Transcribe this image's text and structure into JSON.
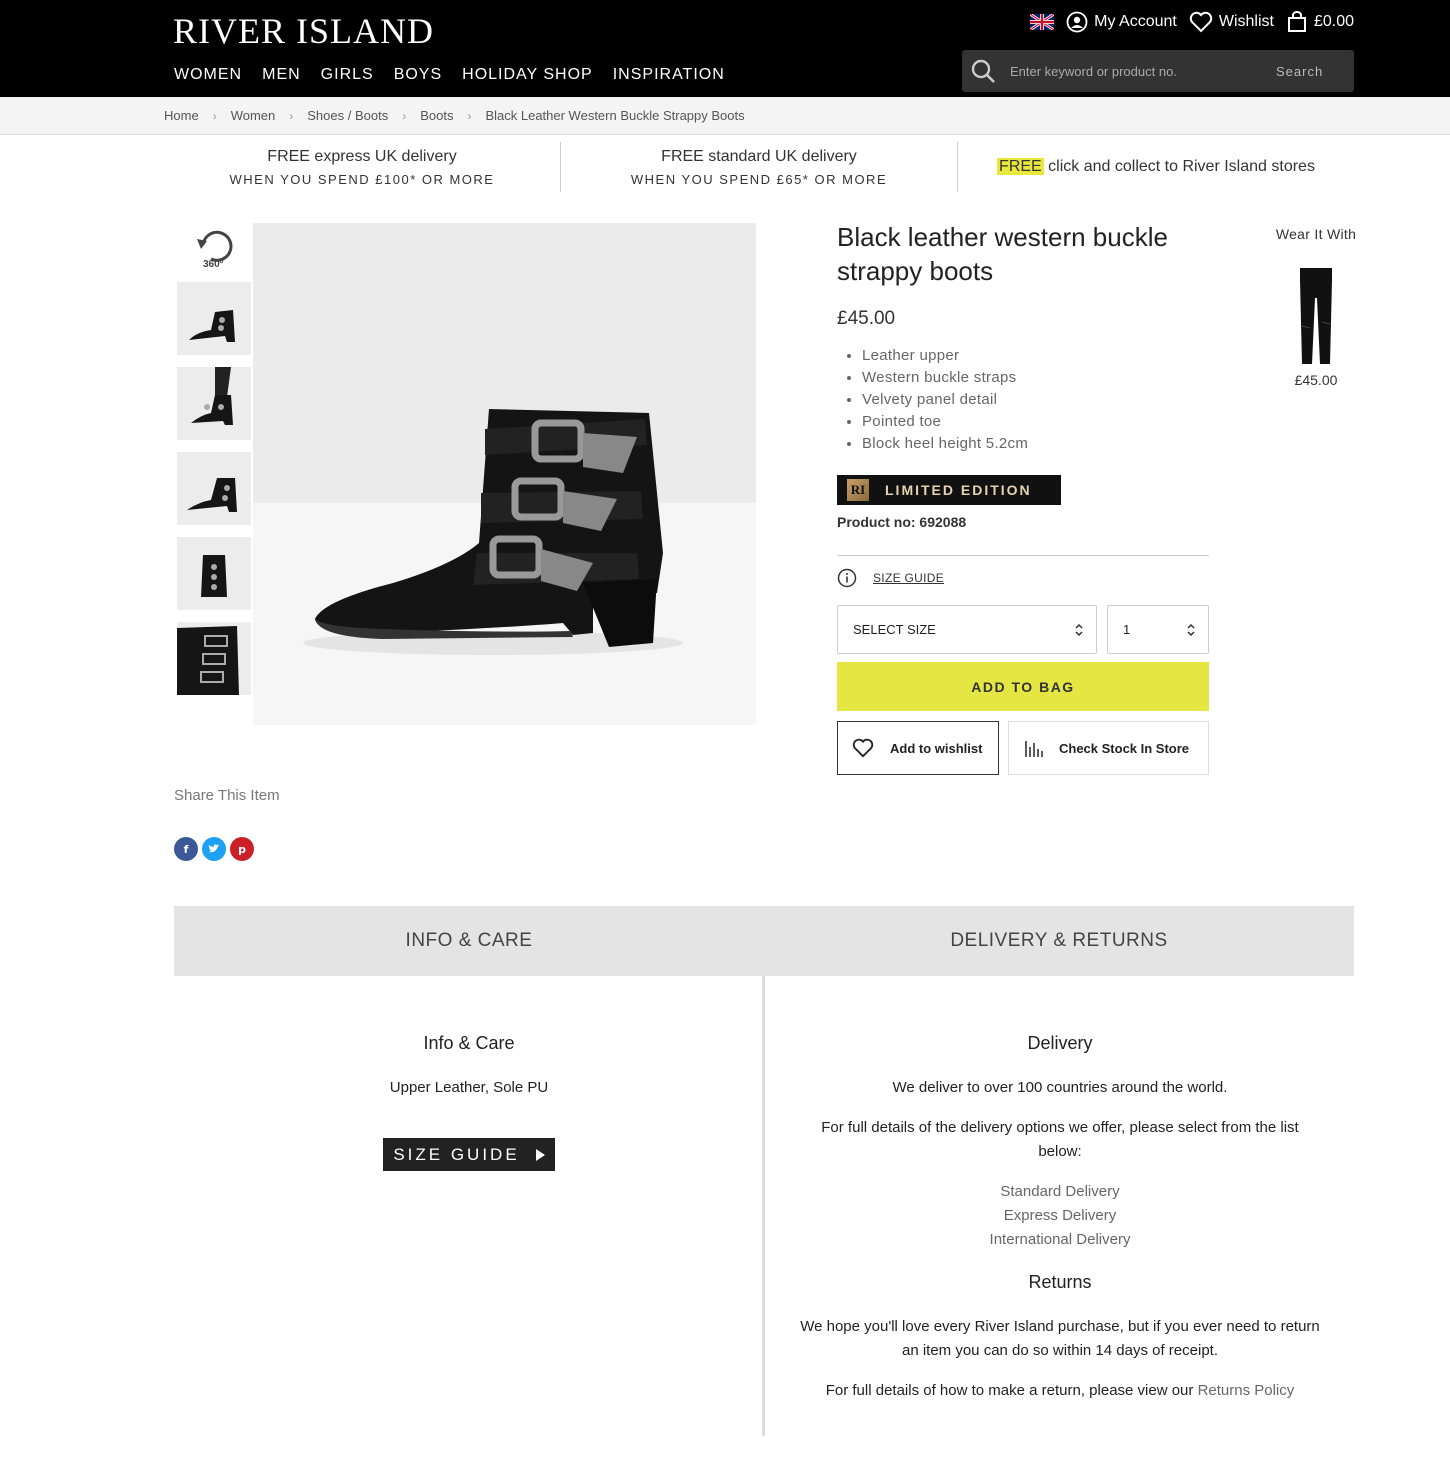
{
  "header": {
    "logo": "RIVER ISLAND",
    "account_label": "My Account",
    "wishlist_label": "Wishlist",
    "bag_total": "£0.00",
    "nav": [
      "WOMEN",
      "MEN",
      "GIRLS",
      "BOYS",
      "HOLIDAY SHOP",
      "INSPIRATION"
    ],
    "search_placeholder": "Enter keyword or product no.",
    "search_button": "Search"
  },
  "breadcrumb": [
    "Home",
    "Women",
    "Shoes / Boots",
    "Boots",
    "Black Leather Western Buckle Strappy Boots"
  ],
  "promos": [
    {
      "line1": "FREE express UK delivery",
      "line2": "WHEN YOU SPEND £100* OR MORE"
    },
    {
      "line1": "FREE standard UK delivery",
      "line2": "WHEN YOU SPEND £65* OR MORE"
    },
    {
      "highlight": "FREE",
      "rest": " click and collect to River Island stores"
    }
  ],
  "gallery": {
    "rotate_label": "360°",
    "thumb_count": 5
  },
  "product": {
    "title": "Black leather western buckle strappy boots",
    "price": "£45.00",
    "features": [
      "Leather upper",
      "Western buckle straps",
      "Velvety panel detail",
      "Pointed toe",
      "Block heel height 5.2cm"
    ],
    "badge": "LIMITED EDITION",
    "badge_logo": "RI",
    "product_no": "Product no: 692088",
    "size_guide_link": "SIZE GUIDE",
    "size_select": "SELECT SIZE",
    "qty_select": "1",
    "add_to_bag": "ADD TO BAG",
    "add_to_wishlist": "Add to wishlist",
    "check_stock": "Check Stock In Store"
  },
  "wear_it_with": {
    "title": "Wear It With",
    "price": "£45.00"
  },
  "share": {
    "title": "Share This Item",
    "icons": [
      "facebook-icon",
      "twitter-icon",
      "pinterest-icon"
    ],
    "colors": {
      "facebook": "#3b5998",
      "twitter": "#1da1f2",
      "pinterest": "#cb2027"
    }
  },
  "tabs": {
    "info": "INFO & CARE",
    "delivery": "DELIVERY & RETURNS"
  },
  "info_care": {
    "heading": "Info & Care",
    "text": "Upper Leather, Sole PU",
    "size_guide_button": "SIZE GUIDE"
  },
  "delivery": {
    "heading": "Delivery",
    "p1": "We deliver to over 100 countries around the world.",
    "p2": "For full details of the delivery options we offer, please select from the list below:",
    "links": [
      "Standard Delivery",
      "Express Delivery",
      "International Delivery"
    ],
    "returns_heading": "Returns",
    "p3": "We hope you'll love every River Island purchase, but if you ever need to return an item you can do so within 14 days of receipt.",
    "p4": "For full details of how to make a return, please view our ",
    "p4_link": "Returns Policy"
  },
  "colors": {
    "accent_yellow": "#e6e643",
    "header_bg": "#000000"
  }
}
